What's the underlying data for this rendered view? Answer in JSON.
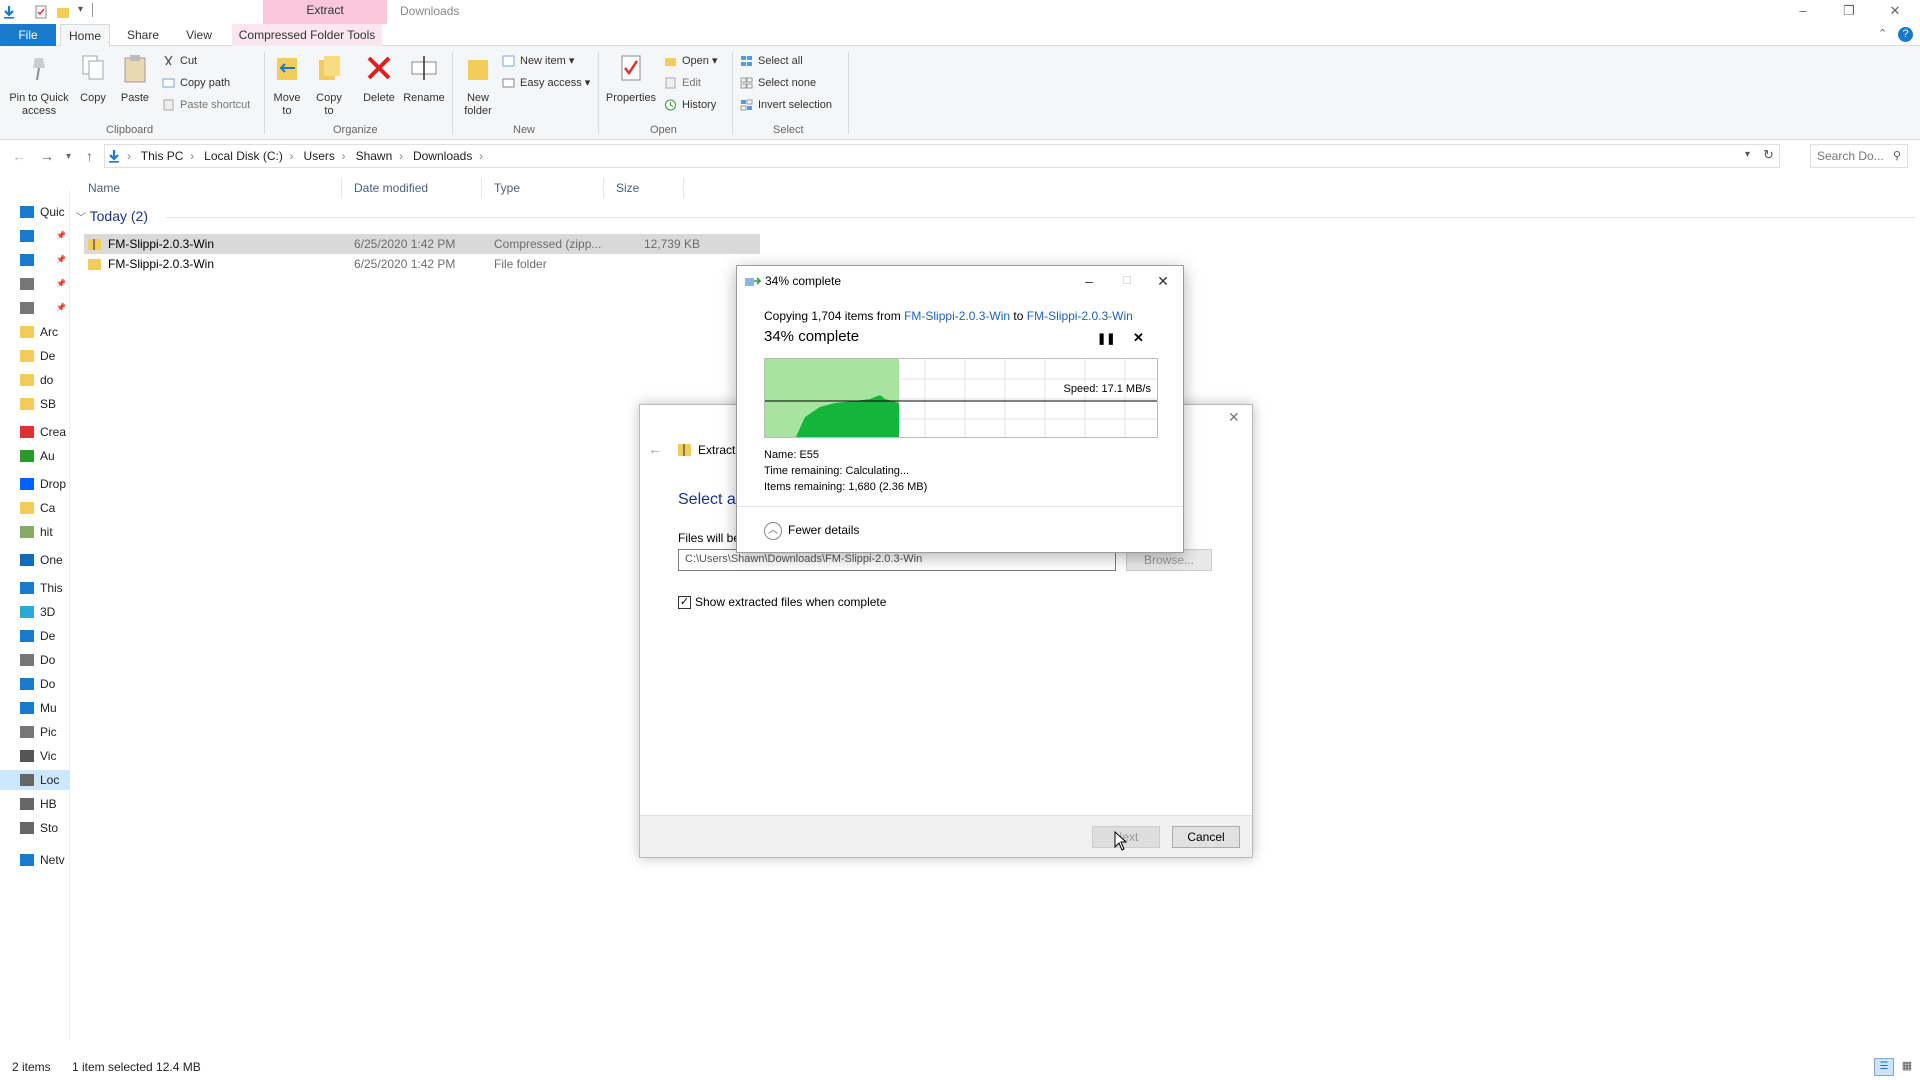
{
  "window": {
    "title": "Downloads",
    "context_tab": "Extract",
    "controls": {
      "minimize": "–",
      "maximize": "❐",
      "close": "✕"
    }
  },
  "ribbon_tabs": {
    "file": "File",
    "home": "Home",
    "share": "Share",
    "view": "View",
    "compressed": "Compressed Folder Tools"
  },
  "ribbon": {
    "clipboard": {
      "pin": "Pin to Quick access",
      "copy": "Copy",
      "paste": "Paste",
      "cut": "Cut",
      "copy_path": "Copy path",
      "paste_shortcut": "Paste shortcut",
      "label": "Clipboard"
    },
    "organize": {
      "move_to": "Move to",
      "copy_to": "Copy to",
      "delete": "Delete",
      "rename": "Rename",
      "label": "Organize"
    },
    "new": {
      "new_folder": "New folder",
      "new_item": "New item",
      "easy_access": "Easy access",
      "label": "New"
    },
    "open": {
      "properties": "Properties",
      "open": "Open",
      "edit": "Edit",
      "history": "History",
      "label": "Open"
    },
    "select": {
      "select_all": "Select all",
      "select_none": "Select none",
      "invert": "Invert selection",
      "label": "Select"
    }
  },
  "address": {
    "crumbs": [
      "This PC",
      "Local Disk (C:)",
      "Users",
      "Shawn",
      "Downloads"
    ],
    "search_placeholder": "Search Do..."
  },
  "nav": {
    "items": [
      {
        "label": "Quic",
        "icon": "star-icon"
      },
      {
        "label": "",
        "icon": "desktop-icon"
      },
      {
        "label": "",
        "icon": "download-icon"
      },
      {
        "label": "",
        "icon": "document-icon"
      },
      {
        "label": "",
        "icon": "picture-icon"
      },
      {
        "label": "Arc",
        "icon": "folder-icon"
      },
      {
        "label": "De",
        "icon": "folder-icon"
      },
      {
        "label": "do",
        "icon": "folder-icon"
      },
      {
        "label": "SB",
        "icon": "folder-icon"
      },
      {
        "label": "Crea",
        "icon": "creative-cloud-icon"
      },
      {
        "label": "Au",
        "icon": "app-icon"
      },
      {
        "label": "Drop",
        "icon": "dropbox-icon"
      },
      {
        "label": "Ca",
        "icon": "folder-icon"
      },
      {
        "label": "hit",
        "icon": "image-icon"
      },
      {
        "label": "One",
        "icon": "onedrive-icon"
      },
      {
        "label": "This",
        "icon": "pc-icon"
      },
      {
        "label": "3D",
        "icon": "3d-objects-icon"
      },
      {
        "label": "De",
        "icon": "desktop-icon"
      },
      {
        "label": "Do",
        "icon": "document-icon"
      },
      {
        "label": "Do",
        "icon": "download-icon"
      },
      {
        "label": "Mu",
        "icon": "music-icon"
      },
      {
        "label": "Pic",
        "icon": "picture-icon"
      },
      {
        "label": "Vic",
        "icon": "video-icon"
      },
      {
        "label": "Loc",
        "icon": "drive-icon"
      },
      {
        "label": "HB",
        "icon": "drive-icon"
      },
      {
        "label": "Sto",
        "icon": "drive-icon"
      },
      {
        "label": "Netv",
        "icon": "network-icon"
      }
    ]
  },
  "filelist": {
    "columns": [
      "Name",
      "Date modified",
      "Type",
      "Size"
    ],
    "group": "Today (2)",
    "rows": [
      {
        "name": "FM-Slippi-2.0.3-Win",
        "date": "6/25/2020 1:42 PM",
        "type": "Compressed (zipp...",
        "size": "12,739 KB",
        "icon": "zip-folder-icon"
      },
      {
        "name": "FM-Slippi-2.0.3-Win",
        "date": "6/25/2020 1:42 PM",
        "type": "File folder",
        "size": "",
        "icon": "folder-icon"
      }
    ]
  },
  "status": {
    "count": "2 items",
    "selection": "1 item selected  12.4 MB"
  },
  "wizard": {
    "title": "Extract",
    "heading": "Select a",
    "files_label": "Files will be",
    "path": "C:\\Users\\Shawn\\Downloads\\FM-Slippi-2.0.3-Win",
    "browse": "Browse...",
    "show_checkbox": "Show extracted files when complete",
    "next": "Next",
    "cancel": "Cancel"
  },
  "copy": {
    "title": "34% complete",
    "info_prefix": "Copying 1,704 items from ",
    "from": "FM-Slippi-2.0.3-Win",
    "to_word": " to ",
    "to": "FM-Slippi-2.0.3-Win",
    "big": "34% complete",
    "progress": 0.34,
    "speed": "Speed: 17.1 MB/s",
    "name": "Name:  E55",
    "time": "Time remaining:  Calculating...",
    "items": "Items remaining:  1,680 (2.36 MB)",
    "fewer": "Fewer details"
  }
}
